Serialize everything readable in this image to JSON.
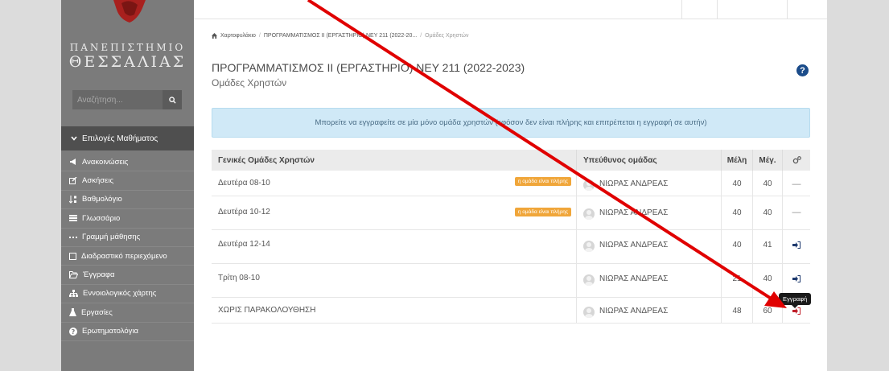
{
  "university": {
    "line1": "ΠΑΝΕΠΙΣΤΗΜΙΟ",
    "line2": "ΘΕΣΣΑΛΙΑΣ"
  },
  "search": {
    "placeholder": "Αναζήτηση..."
  },
  "sidebar": {
    "section_title": "Επιλογές Μαθήματος",
    "items": [
      {
        "label": "Ανακοινώσεις",
        "icon": "bullhorn-icon"
      },
      {
        "label": "Ασκήσεις",
        "icon": "edit-icon"
      },
      {
        "label": "Βαθμολόγιο",
        "icon": "sort-numeric-icon"
      },
      {
        "label": "Γλωσσάριο",
        "icon": "list-icon"
      },
      {
        "label": "Γραμμή μάθησης",
        "icon": "ellipsis-icon"
      },
      {
        "label": "Διαδραστικό περιεχόμενο",
        "icon": "square-icon"
      },
      {
        "label": "Έγγραφα",
        "icon": "folder-open-icon"
      },
      {
        "label": "Εννοιολογικός χάρτης",
        "icon": "sitemap-icon"
      },
      {
        "label": "Εργασίες",
        "icon": "flask-icon"
      },
      {
        "label": "Ερωτηματολόγια",
        "icon": "question-circle-icon"
      }
    ]
  },
  "breadcrumb": {
    "home": "Χαρτοφυλάκιο",
    "course": "ΠΡΟΓΡΑΜΜΑΤΙΣΜΟΣ ΙΙ (ΕΡΓΑΣΤΗΡΙΟ) ΝΕΥ 211 (2022-20...",
    "current": "Ομάδες Χρηστών"
  },
  "page": {
    "title": "ΠΡΟΓΡΑΜΜΑΤΙΣΜΟΣ ΙΙ (ΕΡΓΑΣΤΗΡΙΟ) ΝΕΥ 211 (2022-2023)",
    "subtitle": "Ομάδες Χρηστών",
    "help": "?"
  },
  "alert": {
    "text": "Μπορείτε να εγγραφείτε σε μία μόνο ομάδα χρηστών (εφόσον δεν είναι πλήρης και επιτρέπεται η εγγραφή σε αυτήν)"
  },
  "table": {
    "headers": {
      "group": "Γενικές Ομάδες Χρηστών",
      "leader": "Υπεύθυνος ομάδας",
      "members": "Μέλη",
      "max": "Μέγ."
    },
    "rows": [
      {
        "name": "Δευτέρα 08-10",
        "badge": "η ομάδα είναι πλήρης",
        "leader": "ΝΙΩΡΑΣ ΑΝΔΡΕΑΣ",
        "members": "40",
        "max": "40",
        "action": "—"
      },
      {
        "name": "Δευτέρα 10-12",
        "badge": "η ομάδα είναι πλήρης",
        "leader": "ΝΙΩΡΑΣ ΑΝΔΡΕΑΣ",
        "members": "40",
        "max": "40",
        "action": "—"
      },
      {
        "name": "Δευτέρα 12-14",
        "badge": "",
        "leader": "ΝΙΩΡΑΣ ΑΝΔΡΕΑΣ",
        "members": "40",
        "max": "41",
        "action": "sign-in-icon"
      },
      {
        "name": "Τρίτη 08-10",
        "badge": "",
        "leader": "ΝΙΩΡΑΣ ΑΝΔΡΕΑΣ",
        "members": "21",
        "max": "40",
        "action": "sign-in-icon"
      },
      {
        "name": "ΧΩΡΙΣ ΠΑΡΑΚΟΛΟΥΘΗΣΗ",
        "badge": "",
        "leader": "ΝΙΩΡΑΣ ΑΝΔΡΕΑΣ",
        "members": "48",
        "max": "60",
        "action": "sign-in-icon"
      }
    ]
  },
  "tooltip": {
    "text": "Εγγραφή"
  },
  "colors": {
    "sidebar": "#7b7b7b",
    "badge": "#f0a63a",
    "alert_bg": "#d0e9f7",
    "arrow": "#e00000",
    "help": "#1b4c8a"
  }
}
